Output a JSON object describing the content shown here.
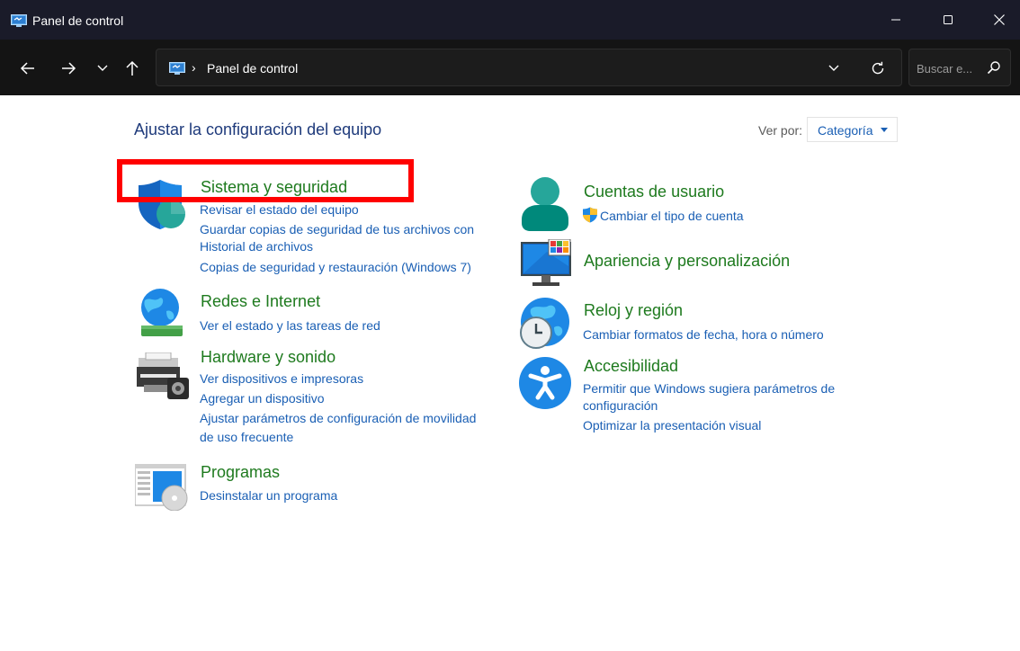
{
  "window": {
    "title": "Panel de control"
  },
  "address": {
    "breadcrumb": "Panel de control",
    "separator": "›"
  },
  "search": {
    "placeholder": "Buscar e..."
  },
  "content": {
    "heading": "Ajustar la configuración del equipo",
    "view_by_label": "Ver por:",
    "view_by_value": "Categoría"
  },
  "left_categories": [
    {
      "title": "Sistema y seguridad",
      "links": [
        "Revisar el estado del equipo",
        "Guardar copias de seguridad de tus archivos con",
        "Historial de archivos",
        "Copias de seguridad y restauración (Windows 7)"
      ]
    },
    {
      "title": "Redes e Internet",
      "links": [
        "Ver el estado y las tareas de red"
      ]
    },
    {
      "title": "Hardware y sonido",
      "links": [
        "Ver dispositivos e impresoras",
        "Agregar un dispositivo",
        "Ajustar parámetros de configuración de movilidad",
        "de uso frecuente"
      ]
    },
    {
      "title": "Programas",
      "links": [
        "Desinstalar un programa"
      ]
    }
  ],
  "right_categories": [
    {
      "title": "Cuentas de usuario",
      "links": [
        "Cambiar el tipo de cuenta"
      ]
    },
    {
      "title": "Apariencia y personalización",
      "links": []
    },
    {
      "title": "Reloj y región",
      "links": [
        "Cambiar formatos de fecha, hora o número"
      ]
    },
    {
      "title": "Accesibilidad",
      "links": [
        "Permitir que Windows sugiera parámetros de",
        "configuración",
        "Optimizar la presentación visual"
      ]
    }
  ],
  "colors": {
    "titlebar": "#1a1b29",
    "navbar": "#141414",
    "category_green": "#1e7a1e",
    "link_blue": "#1a5fb4",
    "heading_blue": "#1e3a7b",
    "highlight_red": "#ff0000"
  },
  "icons": [
    "control-panel-icon",
    "minimize-icon",
    "maximize-icon",
    "close-icon",
    "back-arrow-icon",
    "forward-arrow-icon",
    "recent-chevron-icon",
    "up-arrow-icon",
    "refresh-icon",
    "search-icon",
    "shield-icon",
    "globe-network-icon",
    "printer-icon",
    "programs-icon",
    "user-icon",
    "uac-shield-icon",
    "monitor-icon",
    "clock-globe-icon",
    "accessibility-icon"
  ]
}
